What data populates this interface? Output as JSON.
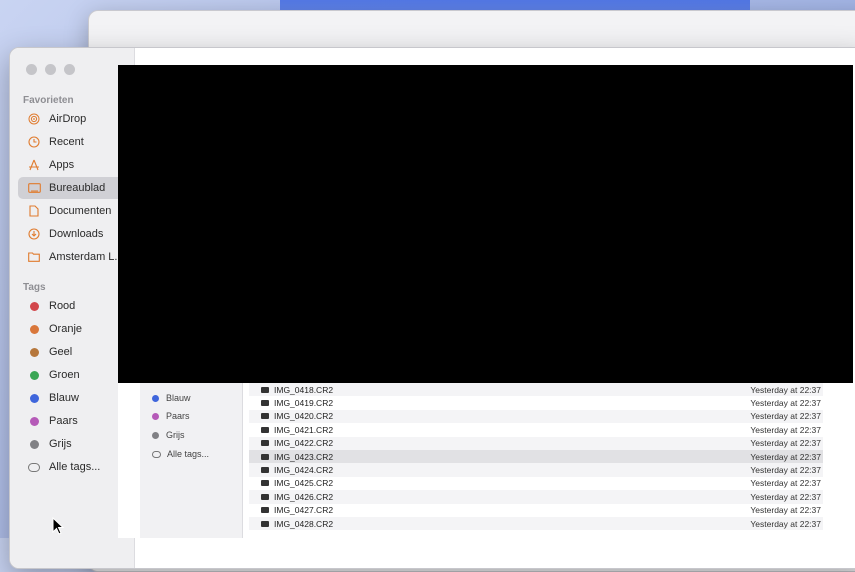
{
  "sidebar": {
    "favorites_title": "Favorieten",
    "favorites": [
      {
        "label": "AirDrop",
        "icon": "airdrop-icon"
      },
      {
        "label": "Recent",
        "icon": "clock-icon"
      },
      {
        "label": "Apps",
        "icon": "apps-icon"
      },
      {
        "label": "Bureaublad",
        "icon": "desktop-icon",
        "selected": true
      },
      {
        "label": "Documenten",
        "icon": "document-icon"
      },
      {
        "label": "Downloads",
        "icon": "download-icon"
      },
      {
        "label": "Amsterdam L...",
        "icon": "folder-icon"
      }
    ],
    "tags_title": "Tags",
    "tags": [
      {
        "label": "Rood",
        "color": "#d2474c"
      },
      {
        "label": "Oranje",
        "color": "#d9773b"
      },
      {
        "label": "Geel",
        "color": "#b6773c"
      },
      {
        "label": "Groen",
        "color": "#3aa655"
      },
      {
        "label": "Blauw",
        "color": "#3f66dc"
      },
      {
        "label": "Paars",
        "color": "#b55ab8"
      },
      {
        "label": "Grijs",
        "color": "#808084"
      },
      {
        "label": "Alle tags...",
        "color": ""
      }
    ]
  },
  "inner_sidebar": {
    "items": [
      {
        "label": "Blauw",
        "color": "#3f66dc"
      },
      {
        "label": "Paars",
        "color": "#b55ab8"
      },
      {
        "label": "Grijs",
        "color": "#808084"
      },
      {
        "label": "Alle tags...",
        "color": ""
      }
    ]
  },
  "files": [
    {
      "name": "IMG_0418.CR2",
      "date": "Yesterday at 22:37"
    },
    {
      "name": "IMG_0419.CR2",
      "date": "Yesterday at 22:37"
    },
    {
      "name": "IMG_0420.CR2",
      "date": "Yesterday at 22:37"
    },
    {
      "name": "IMG_0421.CR2",
      "date": "Yesterday at 22:37"
    },
    {
      "name": "IMG_0422.CR2",
      "date": "Yesterday at 22:37"
    },
    {
      "name": "IMG_0423.CR2",
      "date": "Yesterday at 22:37",
      "selected": true
    },
    {
      "name": "IMG_0424.CR2",
      "date": "Yesterday at 22:37"
    },
    {
      "name": "IMG_0425.CR2",
      "date": "Yesterday at 22:37"
    },
    {
      "name": "IMG_0426.CR2",
      "date": "Yesterday at 22:37"
    },
    {
      "name": "IMG_0427.CR2",
      "date": "Yesterday at 22:37"
    },
    {
      "name": "IMG_0428.CR2",
      "date": "Yesterday at 22:37"
    }
  ]
}
